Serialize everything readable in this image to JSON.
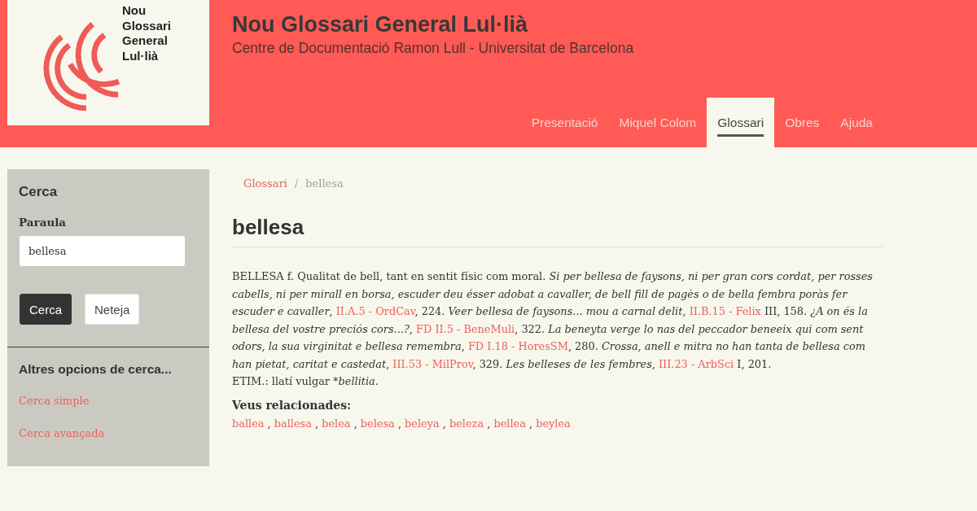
{
  "site": {
    "logo_text": "Nou Glossari General Lul·lià",
    "title": "Nou Glossari General Lul·lià",
    "subtitle": "Centre de Documentació Ramon Lull - Universitat de Barcelona"
  },
  "nav": [
    {
      "label": "Presentació",
      "selected": false
    },
    {
      "label": "Miquel Colom",
      "selected": false
    },
    {
      "label": "Glossari",
      "selected": true
    },
    {
      "label": "Obres",
      "selected": false
    },
    {
      "label": "Ajuda",
      "selected": false
    }
  ],
  "sidebar": {
    "title": "Cerca",
    "field_label": "Paraula",
    "search_value": "bellesa",
    "buttons": [
      {
        "label": "Cerca",
        "kind": "primary"
      },
      {
        "label": "Neteja",
        "kind": "secondary"
      }
    ],
    "more_title": "Altres opcions de cerca...",
    "links": [
      "Cerca simple",
      "Cerca avançada"
    ]
  },
  "breadcrumb": {
    "separator": "/",
    "items": [
      {
        "label": "Glossari",
        "kind": "link"
      },
      {
        "label": "bellesa",
        "kind": "current"
      }
    ]
  },
  "entry": {
    "title": "bellesa",
    "definition": [
      {
        "kind": "text",
        "text": "BELLESA f. Qualitat de bell, tant en sentit físic com moral. "
      },
      {
        "kind": "italic",
        "text": "Si per bellesa de faysons, ni per gran cors cordat, per rosses cabells, ni per mirall en borsa, escuder deu ésser adobat a cavaller, de bell fill de pagès o de bella fembra poràs fer escuder e cavaller"
      },
      {
        "kind": "text",
        "text": ", "
      },
      {
        "kind": "link",
        "text": "II.A.5 - OrdCav"
      },
      {
        "kind": "text",
        "text": ", 224. "
      },
      {
        "kind": "italic",
        "text": "Veer bellesa de faysons... mou a carnal delit"
      },
      {
        "kind": "text",
        "text": ", "
      },
      {
        "kind": "link",
        "text": "II.B.15 - Felix"
      },
      {
        "kind": "text",
        "text": " III, 158. "
      },
      {
        "kind": "italic",
        "text": "¿A on és la bellesa del vostre preciós cors...?"
      },
      {
        "kind": "text",
        "text": ", "
      },
      {
        "kind": "link",
        "text": "FD II.5 - BeneMuli"
      },
      {
        "kind": "text",
        "text": ", 322. "
      },
      {
        "kind": "italic",
        "text": "La beneyta verge lo nas del peccador beneeix qui com sent odors, la sua virginitat e bellesa remembra"
      },
      {
        "kind": "text",
        "text": ", "
      },
      {
        "kind": "link",
        "text": "FD I.18 - HoresSM"
      },
      {
        "kind": "text",
        "text": ", 280. "
      },
      {
        "kind": "italic",
        "text": "Crossa, anell e mitra no han tanta de bellesa com han pietat, caritat e castedat"
      },
      {
        "kind": "text",
        "text": ", "
      },
      {
        "kind": "link",
        "text": "III.53 - MilProv"
      },
      {
        "kind": "text",
        "text": ", 329. "
      },
      {
        "kind": "italic",
        "text": "Les belleses de les fembres"
      },
      {
        "kind": "text",
        "text": ", "
      },
      {
        "kind": "link",
        "text": "III.23 - ArbSci"
      },
      {
        "kind": "text",
        "text": " I, 201."
      }
    ],
    "etymology": [
      {
        "kind": "text",
        "text": "ETIM.: llatí vulgar *"
      },
      {
        "kind": "italic",
        "text": "bellitia."
      }
    ],
    "related": {
      "label": "Veus relacionades:",
      "separator": ",",
      "items": [
        "ballea",
        "ballesa",
        "belea",
        "belesa",
        "beleya",
        "beleza",
        "bellea",
        "beylea"
      ]
    }
  }
}
